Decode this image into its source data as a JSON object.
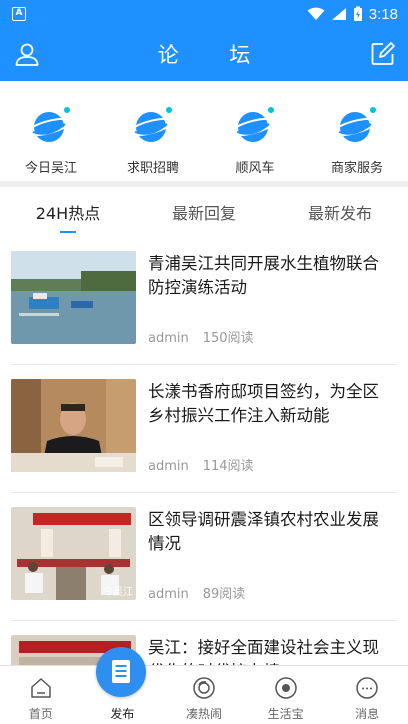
{
  "status_bar": {
    "time": "3:18",
    "app_badge": "A"
  },
  "header": {
    "title": "论 坛"
  },
  "categories": [
    {
      "label": "今日吴江",
      "icon": "planet-icon"
    },
    {
      "label": "求职招聘",
      "icon": "planet-icon"
    },
    {
      "label": "顺风车",
      "icon": "planet-icon"
    },
    {
      "label": "商家服务",
      "icon": "planet-icon"
    }
  ],
  "tabs": [
    {
      "label": "24H热点",
      "active": true
    },
    {
      "label": "最新回复",
      "active": false
    },
    {
      "label": "最新发布",
      "active": false
    }
  ],
  "news": [
    {
      "title": "青浦吴江共同开展水生植物联合防控演练活动",
      "author": "admin",
      "reads": "150阅读"
    },
    {
      "title": "长漾书香府邸项目签约，为全区乡村振兴工作注入新动能",
      "author": "admin",
      "reads": "114阅读"
    },
    {
      "title": "区领导调研震泽镇农村农业发展情况",
      "author": "admin",
      "reads": "89阅读",
      "watermark": "今吴江"
    },
    {
      "title": "吴江：接好全面建设社会主义现代化的时代接力棒",
      "author": "",
      "reads": ""
    }
  ],
  "bottom_nav": [
    {
      "label": "首页",
      "icon": "home-icon"
    },
    {
      "label": "发布",
      "icon": "publish-icon",
      "active": true
    },
    {
      "label": "凑热闹",
      "icon": "lens-icon"
    },
    {
      "label": "生活宝",
      "icon": "eye-icon"
    },
    {
      "label": "消息",
      "icon": "message-icon"
    }
  ],
  "colors": {
    "primary": "#1e90ff",
    "fab": "#2f8ff0"
  }
}
